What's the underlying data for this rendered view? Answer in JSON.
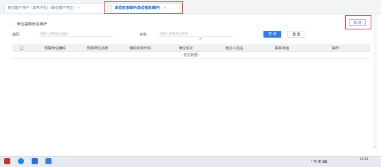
{
  "tabs": [
    {
      "label": "单位账户开户（非电子化）(单位账户开立)",
      "close": "×"
    },
    {
      "label": "单位信息维护(单位信息维护)",
      "close": "×"
    }
  ],
  "page": {
    "back_arrow": "‹",
    "title": "单位基础信息维护",
    "add_button": "新 增"
  },
  "search": {
    "code_label": "编码:",
    "code_placeholder": "请输入预算单位编码",
    "name_label": "名称:",
    "name_placeholder": "请输入预算单位名称",
    "query_button": "查 询",
    "reset_button": "重 置",
    "collapse_icon": "^"
  },
  "table": {
    "columns": [
      "预算单位编码",
      "预算单位名称",
      "组织机构代码",
      "单位级次",
      "经办人姓名",
      "联系电话",
      "操作"
    ],
    "empty_text": "暂无数据~"
  },
  "taskbar": {
    "clock": "14:51",
    "tray_text": "^ 中 英 ⌨"
  },
  "colors": {
    "accent": "#2f7be8",
    "highlight_box": "#e53935",
    "header_bg": "#eef1f6"
  }
}
